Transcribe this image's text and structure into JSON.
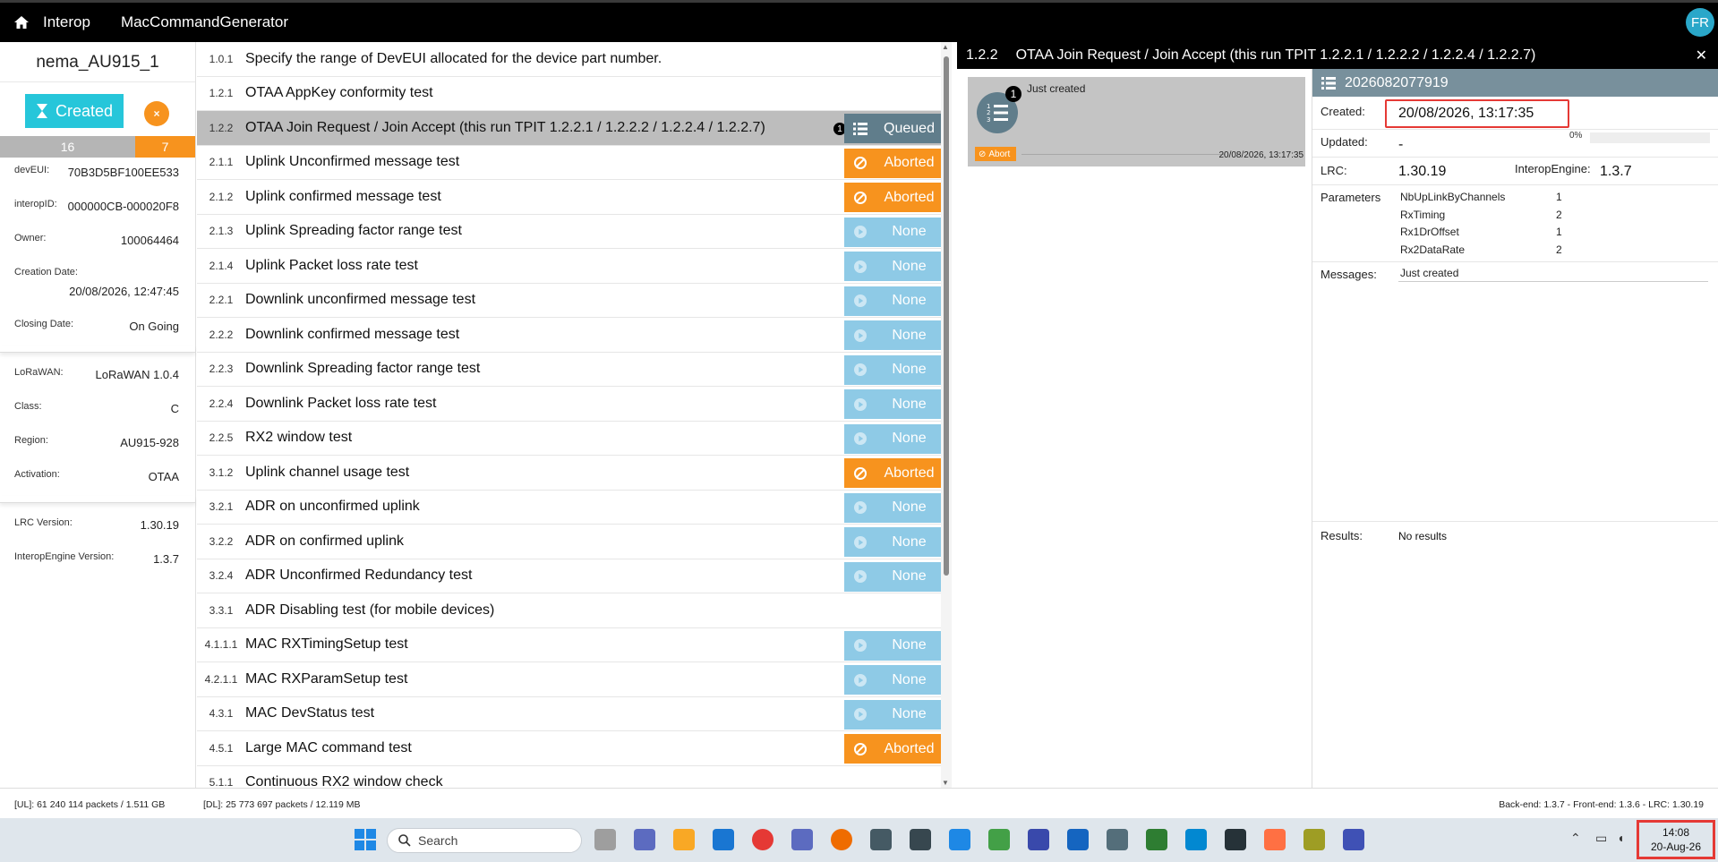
{
  "topbar": {
    "nav_items": [
      "Interop",
      "MacCommandGenerator"
    ],
    "avatar": "FR"
  },
  "device": {
    "name": "nema_AU915_1",
    "status_label": "Created",
    "count_left": "16",
    "count_right": "7",
    "fields": [
      {
        "key": "devEUI:",
        "value": "70B3D5BF100EE533"
      },
      {
        "key": "interopID:",
        "value": "000000CB-000020F8"
      },
      {
        "key": "Owner:",
        "value": "100064464"
      },
      {
        "key": "Creation Date:",
        "value": "20/08/2026, 12:47:45"
      },
      {
        "key": "Closing Date:",
        "value": "On Going"
      },
      {
        "key": "LoRaWAN:",
        "value": "LoRaWAN 1.0.4"
      },
      {
        "key": "Class:",
        "value": "C"
      },
      {
        "key": "Region:",
        "value": "AU915-928"
      },
      {
        "key": "Activation:",
        "value": "OTAA"
      },
      {
        "key": "LRC Version:",
        "value": "1.30.19"
      },
      {
        "key": "InteropEngine Version:",
        "value": "1.3.7"
      }
    ]
  },
  "tests": [
    {
      "num": "1.0.1",
      "title": "Specify the range of DevEUI allocated for the device part number.",
      "status": ""
    },
    {
      "num": "1.2.1",
      "title": "OTAA AppKey conformity test",
      "status": ""
    },
    {
      "num": "1.2.2",
      "title": "OTAA Join Request / Join Accept (this run TPIT 1.2.2.1 / 1.2.2.2 / 1.2.2.4 / 1.2.2.7)",
      "status": "Queued",
      "badge": "1"
    },
    {
      "num": "2.1.1",
      "title": "Uplink Unconfirmed message test",
      "status": "Aborted"
    },
    {
      "num": "2.1.2",
      "title": "Uplink confirmed message test",
      "status": "Aborted"
    },
    {
      "num": "2.1.3",
      "title": "Uplink Spreading factor range test",
      "status": "None"
    },
    {
      "num": "2.1.4",
      "title": "Uplink Packet loss rate test",
      "status": "None"
    },
    {
      "num": "2.2.1",
      "title": "Downlink unconfirmed message test",
      "status": "None"
    },
    {
      "num": "2.2.2",
      "title": "Downlink confirmed message test",
      "status": "None"
    },
    {
      "num": "2.2.3",
      "title": "Downlink Spreading factor range test",
      "status": "None"
    },
    {
      "num": "2.2.4",
      "title": "Downlink Packet loss rate test",
      "status": "None"
    },
    {
      "num": "2.2.5",
      "title": "RX2 window test",
      "status": "None"
    },
    {
      "num": "3.1.2",
      "title": "Uplink channel usage test",
      "status": "Aborted"
    },
    {
      "num": "3.2.1",
      "title": "ADR on unconfirmed uplink",
      "status": "None"
    },
    {
      "num": "3.2.2",
      "title": "ADR on confirmed uplink",
      "status": "None"
    },
    {
      "num": "3.2.4",
      "title": "ADR Unconfirmed Redundancy test",
      "status": "None"
    },
    {
      "num": "3.3.1",
      "title": "ADR Disabling test (for mobile devices)",
      "status": ""
    },
    {
      "num": "4.1.1.1",
      "title": "MAC RXTimingSetup test",
      "status": "None"
    },
    {
      "num": "4.2.1.1",
      "title": "MAC RXParamSetup test",
      "status": "None"
    },
    {
      "num": "4.3.1",
      "title": "MAC DevStatus test",
      "status": "None"
    },
    {
      "num": "4.5.1",
      "title": "Large MAC command test",
      "status": "Aborted"
    },
    {
      "num": "5.1.1",
      "title": "Continuous RX2 window check",
      "status": ""
    }
  ],
  "detail": {
    "num": "1.2.2",
    "title": "OTAA Join Request / Join Accept (this run TPIT 1.2.2.1 / 1.2.2.2 / 1.2.2.4 / 1.2.2.7)",
    "run_card": {
      "badge": "1",
      "message": "Just created",
      "abort_label": "Abort",
      "timestamp": "20/08/2026, 13:17:35"
    },
    "run_id": "2026082077919",
    "created_label": "Created:",
    "created_value": "20/08/2026, 13:17:35",
    "updated_label": "Updated:",
    "updated_value": "-",
    "progress_text": "0%",
    "progress": 0,
    "lrc_label": "LRC:",
    "lrc_value": "1.30.19",
    "interop_label": "InteropEngine:",
    "interop_value": "1.3.7",
    "params_label": "Parameters",
    "params": [
      {
        "name": "NbUpLinkByChannels",
        "value": "1"
      },
      {
        "name": "RxTiming",
        "value": "2"
      },
      {
        "name": "Rx1DrOffset",
        "value": "1"
      },
      {
        "name": "Rx2DataRate",
        "value": "2"
      }
    ],
    "messages_label": "Messages:",
    "messages_value": "Just created",
    "results_label": "Results:",
    "results_value": "No results"
  },
  "footer": {
    "ul": "[UL]: 61 240 114 packets / 1.511 GB",
    "dl": "[DL]: 25 773 697 packets / 12.119 MB",
    "versions": "Back-end: 1.3.7 - Front-end: 1.3.6 - LRC: 1.30.19"
  },
  "taskbar": {
    "search_placeholder": "Search",
    "time": "14:08",
    "date": "20-Aug-26"
  },
  "colors": {
    "aborted": "#f7931e",
    "none": "#8ecae6",
    "queued": "#607d8b",
    "created": "#26c6da",
    "highlight": "#e53935"
  }
}
